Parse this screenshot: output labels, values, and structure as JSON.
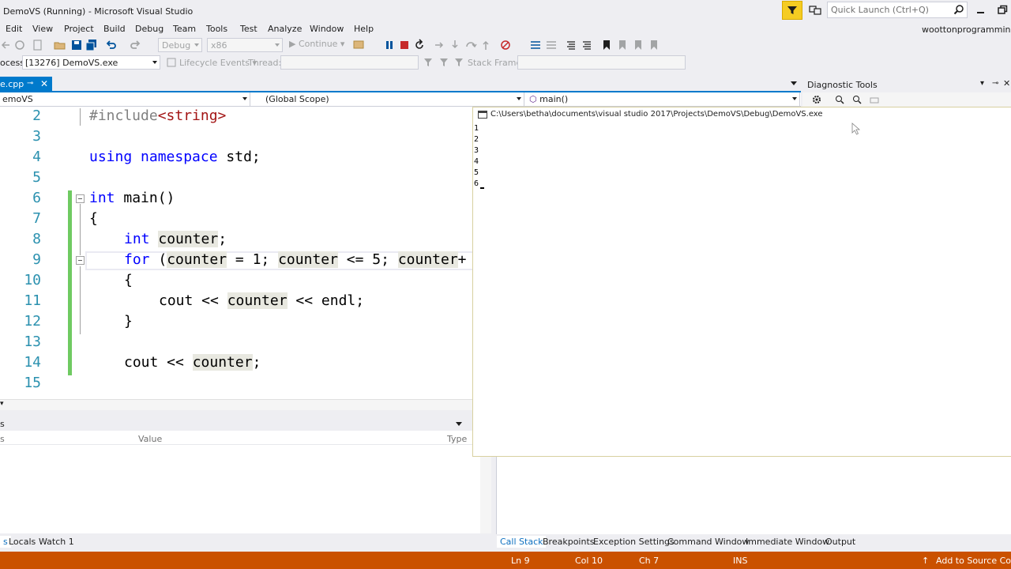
{
  "window": {
    "title": "DemoVS (Running) - Microsoft Visual Studio",
    "quick_launch_placeholder": "Quick Launch (Ctrl+Q)",
    "user": "woottonprogramming"
  },
  "menu": [
    "Edit",
    "View",
    "Project",
    "Build",
    "Debug",
    "Team",
    "Tools",
    "Test",
    "Analyze",
    "Window",
    "Help"
  ],
  "toolbar": {
    "config": "Debug",
    "platform": "x86",
    "continue_label": "Continue"
  },
  "debug_location": {
    "process_label": "ocess:",
    "process_value": "[13276] DemoVS.exe",
    "lifecycle_label": "Lifecycle Events",
    "thread_label": "Thread:",
    "stackframe_label": "Stack Frame:"
  },
  "editor": {
    "tab_label": "e.cpp",
    "nav_project": "emoVS",
    "nav_scope": "(Global Scope)",
    "nav_member": "main()",
    "zoom": "▾"
  },
  "code_lines": [
    {
      "n": "2",
      "text": "#include<string>"
    },
    {
      "n": "3",
      "text": ""
    },
    {
      "n": "4",
      "text": "using namespace std;"
    },
    {
      "n": "5",
      "text": ""
    },
    {
      "n": "6",
      "text": "int main()"
    },
    {
      "n": "7",
      "text": "{"
    },
    {
      "n": "8",
      "text": "int counter;"
    },
    {
      "n": "9",
      "text": "for (counter = 1; counter <= 5; counter+"
    },
    {
      "n": "10",
      "text": "{"
    },
    {
      "n": "11",
      "text": "cout << counter << endl;"
    },
    {
      "n": "12",
      "text": "}"
    },
    {
      "n": "13",
      "text": ""
    },
    {
      "n": "14",
      "text": "cout << counter;"
    },
    {
      "n": "15",
      "text": ""
    }
  ],
  "locals": {
    "header": "s",
    "col_value": "Value",
    "col_type": "Type",
    "tabs": [
      "s",
      "Locals",
      "Watch 1"
    ]
  },
  "callstack_tabs": [
    "Call Stack",
    "Breakpoints",
    "Exception Settings",
    "Command Window",
    "Immediate Window",
    "Output"
  ],
  "diagnostic": {
    "title": "Diagnostic Tools"
  },
  "console": {
    "title": "C:\\Users\\betha\\documents\\visual studio 2017\\Projects\\DemoVS\\Debug\\DemoVS.exe",
    "output": [
      "1",
      "2",
      "3",
      "4",
      "5",
      "6"
    ]
  },
  "status": {
    "line": "Ln 9",
    "col": "Col 10",
    "ch": "Ch 7",
    "mode": "INS",
    "source_control": "Add to Source Contr"
  },
  "colors": {
    "accent": "#007acc",
    "statusbar": "#ca5100",
    "keyword": "#0000ff",
    "line_number": "#2b91af",
    "change_bar": "#6fca62"
  }
}
